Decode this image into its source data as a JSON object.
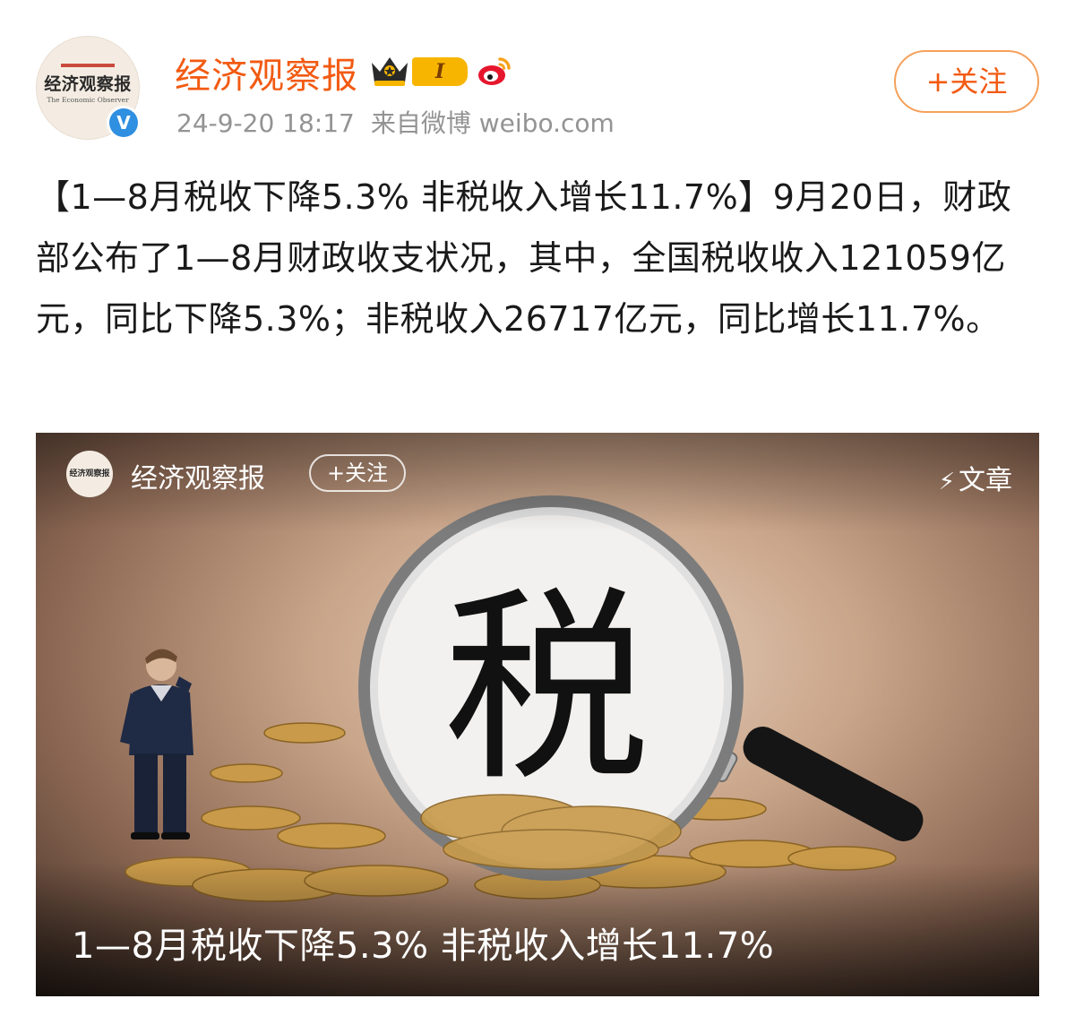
{
  "post": {
    "author": {
      "name": "经济观察报",
      "avatar_text": "经济观察报",
      "avatar_subtext": "The Economic Observer",
      "verified_mark": "V",
      "level_badge": "I"
    },
    "meta": {
      "timestamp": "24-9-20 18:17",
      "source": "来自微博 weibo.com"
    },
    "follow_label": "+关注",
    "text": "【1—8月税收下降5.3% 非税收入增长11.7%】9月20日，财政部公布了1—8月财政收支状况，其中，全国税收收入121059亿元，同比下降5.3%；非税收入26717亿元，同比增长11.7%。"
  },
  "card": {
    "author_name": "经济观察报",
    "avatar_text": "经济观察报",
    "follow_label": "+关注",
    "type_label": "文章",
    "headline": "1—8月税收下降5.3% 非税收入增长11.7%",
    "image_glyph": "税"
  },
  "icons": {
    "crown": "crown-icon",
    "weibo": "weibo-logo-icon",
    "bolt": "bolt-icon",
    "verified": "verified-icon"
  },
  "colors": {
    "author_orange": "#f25a12",
    "follow_border": "#f5a15b",
    "meta_gray": "#939393",
    "verified_blue": "#2f8fe0",
    "badge_gold": "#f7b500"
  }
}
